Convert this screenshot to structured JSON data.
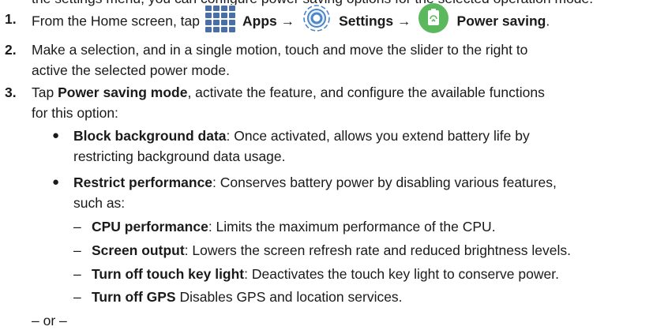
{
  "intro_partial": "the settings menu, you can configure power saving options for the selected operation mode.",
  "steps": {
    "step1": {
      "number": "1.",
      "text_a": "From the Home screen, tap",
      "apps_label": "Apps",
      "arrow1": "→",
      "settings_label": "Settings",
      "arrow2": "→",
      "power_label": "Power saving",
      "end_punct": "."
    },
    "step2": {
      "number": "2.",
      "line1": "Make a selection, and in a single motion, touch and move the slider to the right to",
      "line2": "active the selected power mode."
    },
    "step3": {
      "number": "3.",
      "lead": "Tap ",
      "bold": "Power saving mode",
      "line1_rest": ", activate the feature, and configure the available functions",
      "line2": "for this option:"
    }
  },
  "bullets": [
    {
      "term": "Block background data",
      "line1_rest": ": Once activated, allows you extend battery life by",
      "line2": "restricting background data usage."
    },
    {
      "term": "Restrict performance",
      "line1_rest": ": Conserves battery power by disabling various features,",
      "line2": "such as:"
    }
  ],
  "sub_items": [
    {
      "term": "CPU performance",
      "rest": ": Limits the maximum performance of the CPU."
    },
    {
      "term": "Screen output",
      "rest": ": Lowers the screen refresh rate and reduced brightness levels."
    },
    {
      "term": "Turn off touch key light",
      "rest": ": Deactivates the touch key light to conserve power."
    },
    {
      "term": "Turn off GPS",
      "rest": " Disables GPS and location services."
    }
  ],
  "bullet_glyph": "●",
  "dash_glyph": "–",
  "or_text": "– or –",
  "icons": {
    "apps": "apps-grid-icon",
    "settings": "settings-gear-icon",
    "power": "power-saving-icon"
  },
  "colors": {
    "apps_icon": "#4a6fa5",
    "settings_icon": "#4a86c8",
    "power_icon": "#5cb85c",
    "text": "#1a1a1a"
  }
}
